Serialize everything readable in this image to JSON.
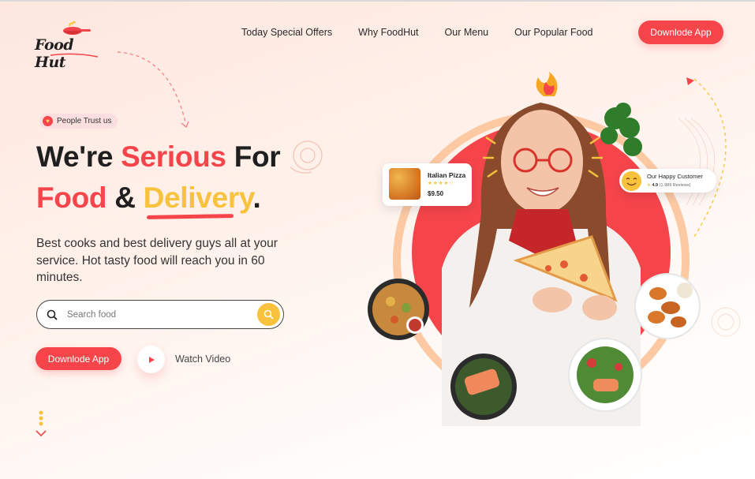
{
  "brand": {
    "name": "Food Hut"
  },
  "nav": {
    "items": [
      "Today Special Offers",
      "Why FoodHut",
      "Our Menu",
      "Our Popular Food"
    ],
    "cta": "Downlode App"
  },
  "hero": {
    "badge": "People Trust us",
    "headline_line1": {
      "part1": "We're ",
      "part2": "Serious",
      "part3": " For"
    },
    "headline_line2": {
      "part1": "Food",
      "part2": " & ",
      "part3": "Delivery",
      "part4": "."
    },
    "description": "Best cooks and best delivery guys all at your service. Hot tasty food will reach you in 60 minutes.",
    "search": {
      "placeholder": "Search food"
    },
    "download_button": "Downlode App",
    "watch_video": "Watch Video"
  },
  "cards": {
    "pizza": {
      "name": "Italian Pizza",
      "rating_stars": 4,
      "price": "$9.50"
    },
    "customer": {
      "title": "Our Happy Customer",
      "rating": "4.9",
      "reviews": "(1.989 Reviews)"
    }
  },
  "colors": {
    "accent_red": "#f5454b",
    "accent_yellow": "#f9c23c",
    "text_dark": "#1f1f1f"
  },
  "icons": [
    "chef-pan-icon",
    "heart-icon",
    "search-icon",
    "play-icon",
    "scroll-down-icon",
    "fire-icon",
    "smile-icon",
    "star-icon"
  ]
}
